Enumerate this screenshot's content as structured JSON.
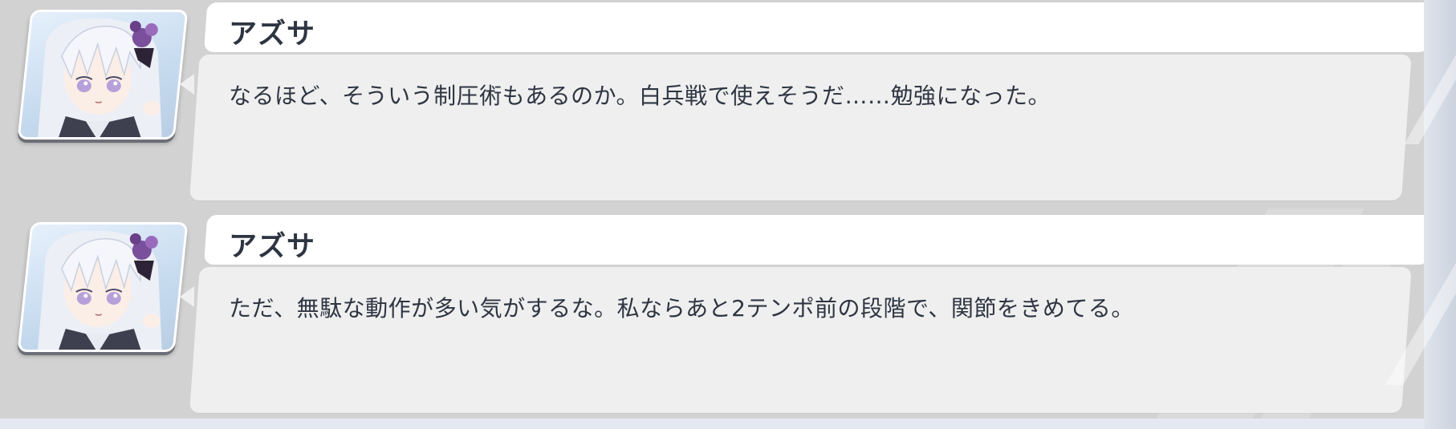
{
  "colors": {
    "panel": "#d2d2d3",
    "name_plate": "#ffffff",
    "bubble": "#efefef",
    "text": "#2e3542",
    "portrait_frame_shadow": "#6d6f78"
  },
  "log": {
    "entries": [
      {
        "speaker": "アズサ",
        "portrait_icon": "azusa-portrait",
        "text": "なるほど、そういう制圧術もあるのか。白兵戦で使えそうだ……勉強になった。"
      },
      {
        "speaker": "アズサ",
        "portrait_icon": "azusa-portrait",
        "text": "ただ、無駄な動作が多い気がするな。私ならあと2テンポ前の段階で、関節をきめてる。"
      }
    ]
  }
}
